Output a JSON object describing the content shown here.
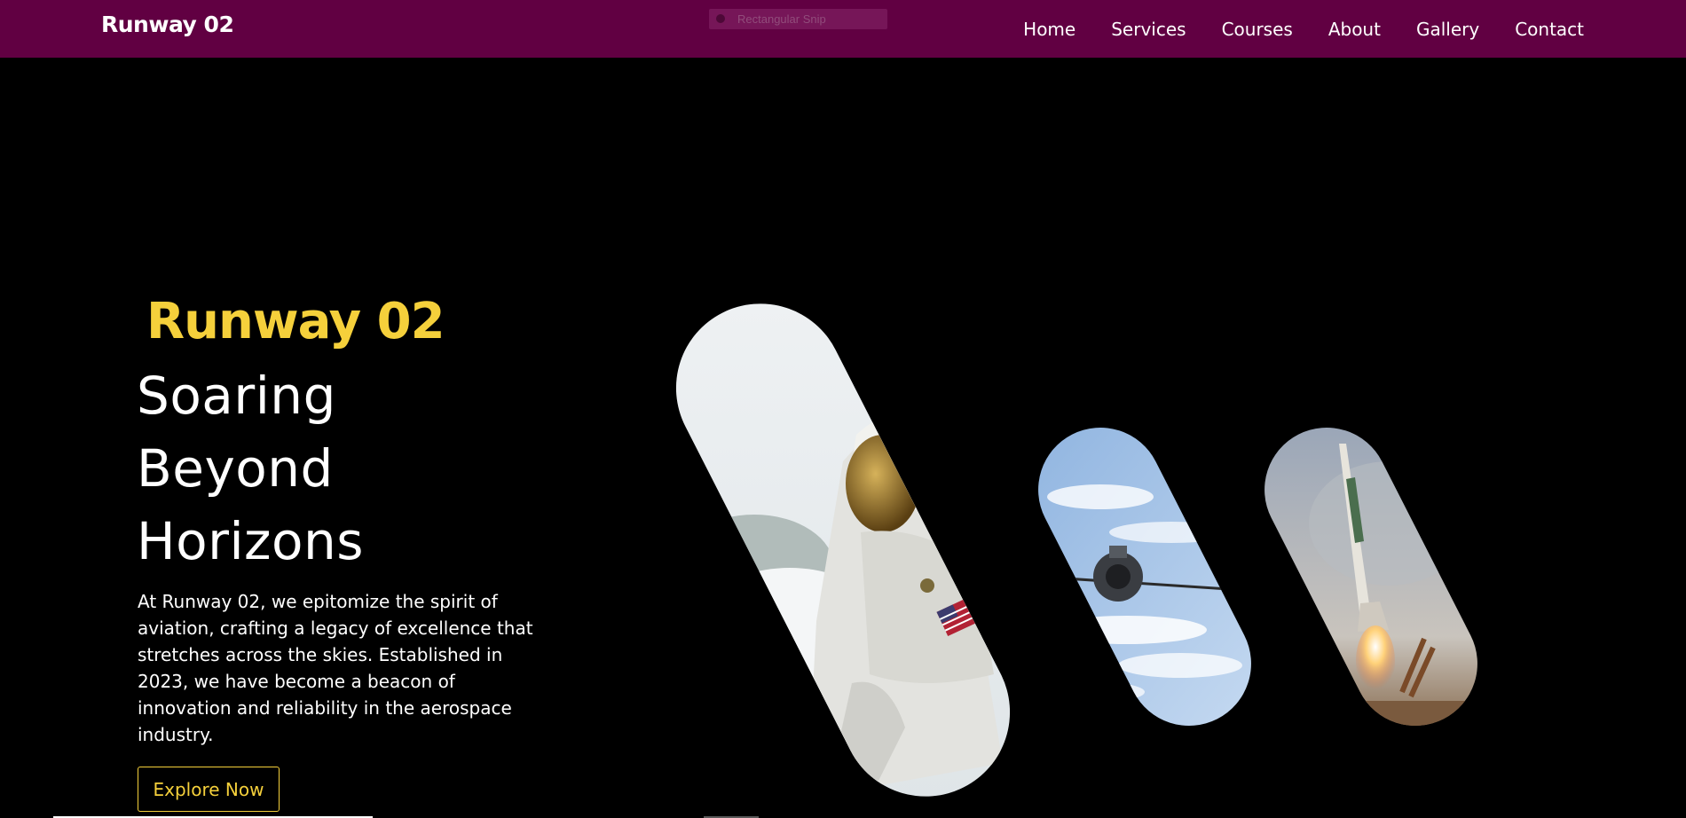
{
  "header": {
    "brand": "Runway 02",
    "snip_overlay_label": "Rectangular Snip",
    "nav": [
      "Home",
      "Services",
      "Courses",
      "About",
      "Gallery",
      "Contact"
    ]
  },
  "hero": {
    "brand_line": "Runway 02",
    "tagline": [
      "Soaring",
      "Beyond",
      "Horizons"
    ],
    "description": "At Runway 02, we epitomize the spirit of aviation, crafting a legacy of excellence that stretches across the skies. Established in 2023, we have become a beacon of innovation and reliability in the aerospace industry.",
    "cta_label": "Explore Now"
  },
  "gallery": {
    "images": [
      {
        "subject": "astronaut-in-spacesuit"
      },
      {
        "subject": "spacecraft-above-clouds"
      },
      {
        "subject": "rocket-launch"
      }
    ]
  },
  "colors": {
    "navbar": "#610042",
    "accent": "#f5d03b",
    "background": "#000000",
    "text": "#ffffff"
  }
}
